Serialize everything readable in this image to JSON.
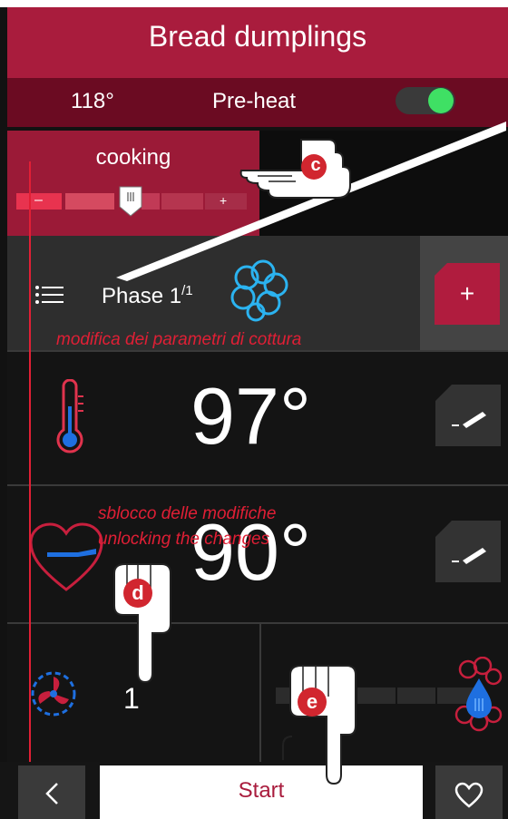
{
  "header": {
    "title": "Bread dumplings"
  },
  "status_bar": {
    "temperature": "118°",
    "mode": "Pre-heat",
    "preheat_enabled": true,
    "accent": "#a91c3d",
    "toggle_color": "#3fe064"
  },
  "cooking_panel": {
    "label": "cooking",
    "minus": "–",
    "plus": "+",
    "level_fraction": 0.5,
    "thumb_label": "III"
  },
  "phase": {
    "label": "Phase 1",
    "superscript": "/1",
    "icon": "steam-cloud-icon",
    "add_label": "+"
  },
  "temperature_row": {
    "value": "97°",
    "icon": "thermometer-icon"
  },
  "core_row": {
    "value": "90°",
    "icon": "heart-probe-icon"
  },
  "fan_row": {
    "value": "1",
    "icon": "fan-icon"
  },
  "humidity_row": {
    "icon": "humidity-drop-icon"
  },
  "annotations": {
    "edit_params": "modifica dei parametri di cottura",
    "unlock_it": "sblocco delle modifiche",
    "unlock_en": "unlocking the changes",
    "c": "c",
    "d": "d",
    "e": "e"
  },
  "footer": {
    "back_icon": "chevron-left-icon",
    "start_label": "Start",
    "favorite_icon": "heart-outline-icon"
  }
}
